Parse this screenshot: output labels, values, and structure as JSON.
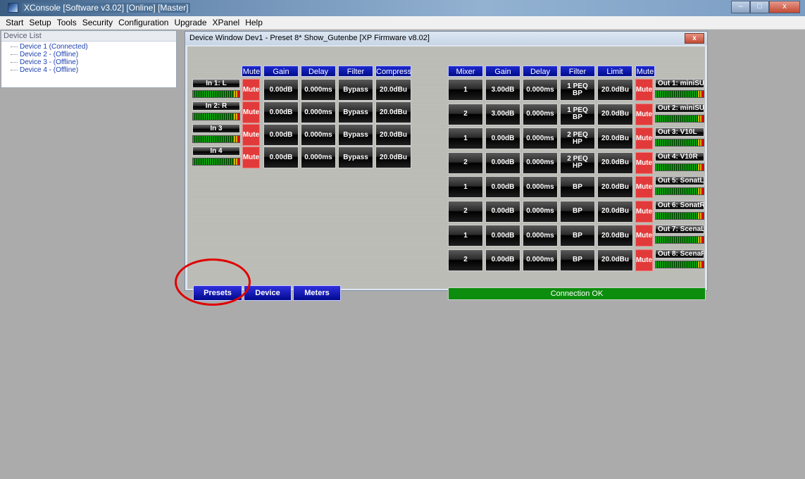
{
  "window": {
    "title": "XConsole [Software v3.02] [Online] [Master]",
    "controls": [
      "–",
      "□",
      "x"
    ]
  },
  "menu": [
    "Start",
    "Setup",
    "Tools",
    "Security",
    "Configuration",
    "Upgrade",
    "XPanel",
    "Help"
  ],
  "device_list": {
    "header": "Device List",
    "items": [
      "Device 1 (Connected)",
      "Device 2 -  (Offline)",
      "Device 3 -  (Offline)",
      "Device 4 -  (Offline)"
    ]
  },
  "device_window": {
    "title": "Device Window Dev1 -  Preset 8*  Show_Gutenbe [XP Firmware v8.02]",
    "close": "x",
    "input_headers": {
      "mute": "Mute",
      "gain": "Gain",
      "delay": "Delay",
      "filter": "Filter",
      "compress": "Compress"
    },
    "inputs": [
      {
        "name": "In 1: L",
        "mute": "Mute",
        "gain": "0.00dB",
        "delay": "0.000ms",
        "filter": "Bypass",
        "compress": "20.0dBu"
      },
      {
        "name": "In 2: R",
        "mute": "Mute",
        "gain": "0.00dB",
        "delay": "0.000ms",
        "filter": "Bypass",
        "compress": "20.0dBu"
      },
      {
        "name": "In 3",
        "mute": "Mute",
        "gain": "0.00dB",
        "delay": "0.000ms",
        "filter": "Bypass",
        "compress": "20.0dBu"
      },
      {
        "name": "In 4",
        "mute": "Mute",
        "gain": "0.00dB",
        "delay": "0.000ms",
        "filter": "Bypass",
        "compress": "20.0dBu"
      }
    ],
    "output_headers": {
      "mixer": "Mixer",
      "gain": "Gain",
      "delay": "Delay",
      "filter": "Filter",
      "limit": "Limit",
      "mute": "Mute"
    },
    "outputs": [
      {
        "mixer": "1",
        "gain": "3.00dB",
        "delay": "0.000ms",
        "filter_a": "1 PEQ",
        "filter_b": "BP",
        "limit": "20.0dBu",
        "mute": "Mute",
        "name": "Out 1: miniSU"
      },
      {
        "mixer": "2",
        "gain": "3.00dB",
        "delay": "0.000ms",
        "filter_a": "1 PEQ",
        "filter_b": "BP",
        "limit": "20.0dBu",
        "mute": "Mute",
        "name": "Out 2: miniSU"
      },
      {
        "mixer": "1",
        "gain": "0.00dB",
        "delay": "0.000ms",
        "filter_a": "2 PEQ",
        "filter_b": "HP",
        "limit": "20.0dBu",
        "mute": "Mute",
        "name": "Out 3: V10L"
      },
      {
        "mixer": "2",
        "gain": "0.00dB",
        "delay": "0.000ms",
        "filter_a": "2 PEQ",
        "filter_b": "HP",
        "limit": "20.0dBu",
        "mute": "Mute",
        "name": "Out 4: V10R"
      },
      {
        "mixer": "1",
        "gain": "0.00dB",
        "delay": "0.000ms",
        "filter_a": "BP",
        "filter_b": "",
        "limit": "20.0dBu",
        "mute": "Mute",
        "name": "Out 5: SonatL"
      },
      {
        "mixer": "2",
        "gain": "0.00dB",
        "delay": "0.000ms",
        "filter_a": "BP",
        "filter_b": "",
        "limit": "20.0dBu",
        "mute": "Mute",
        "name": "Out 6: SonatR"
      },
      {
        "mixer": "1",
        "gain": "0.00dB",
        "delay": "0.000ms",
        "filter_a": "BP",
        "filter_b": "",
        "limit": "20.0dBu",
        "mute": "Mute",
        "name": "Out 7: ScenaL"
      },
      {
        "mixer": "2",
        "gain": "0.00dB",
        "delay": "0.000ms",
        "filter_a": "BP",
        "filter_b": "",
        "limit": "20.0dBu",
        "mute": "Mute",
        "name": "Out 8: ScenaR"
      }
    ],
    "nav": {
      "presets": "Presets",
      "device": "Device",
      "meters": "Meters"
    },
    "status": "Connection OK"
  },
  "colors": {
    "mute": "#e23a3a",
    "header_blue": "#0b16b0",
    "status_green": "#0d8d0d",
    "highlight": "#e00000"
  }
}
